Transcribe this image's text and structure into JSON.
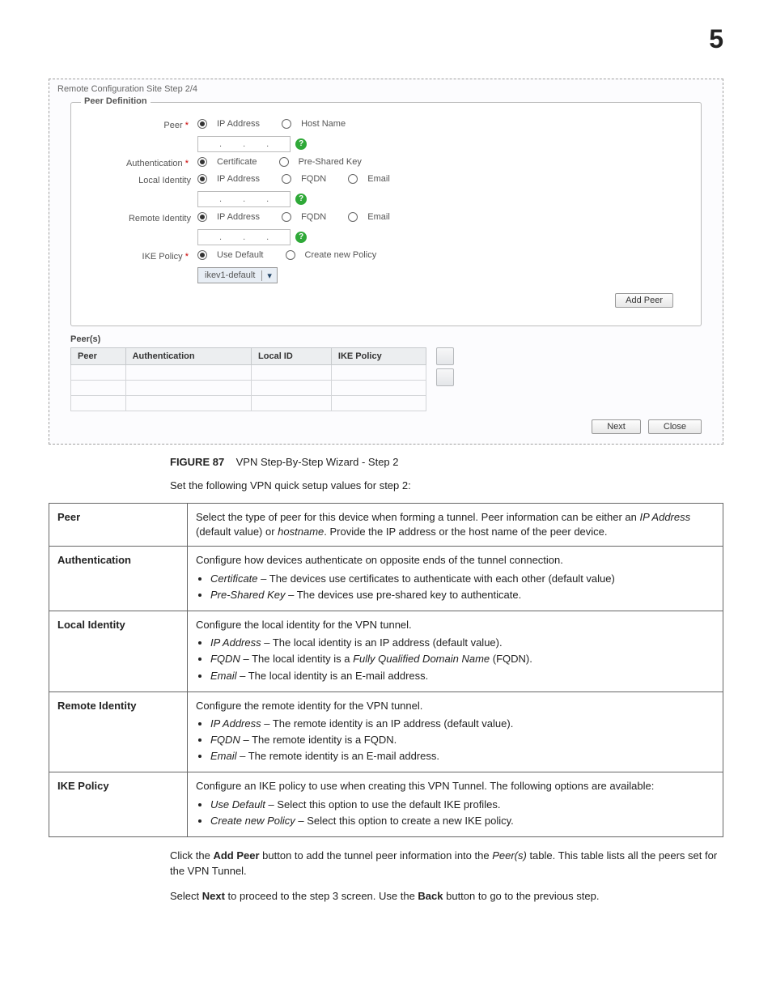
{
  "page_number": "5",
  "screenshot": {
    "title": "Remote Configuration Site  Step 2/4",
    "legend": "Peer Definition",
    "rows": {
      "peer_lbl": "Peer",
      "auth_lbl": "Authentication",
      "localid_lbl": "Local Identity",
      "remoteid_lbl": "Remote Identity",
      "ike_lbl": "IKE Policy"
    },
    "options": {
      "ip_address": "IP Address",
      "host_name": "Host Name",
      "certificate": "Certificate",
      "psk": "Pre-Shared Key",
      "fqdn": "FQDN",
      "email": "Email",
      "use_default": "Use Default",
      "create_new": "Create new Policy"
    },
    "dropdown_value": "ikev1-default",
    "add_peer_btn": "Add Peer",
    "peers_label": "Peer(s)",
    "table_headers": [
      "Peer",
      "Authentication",
      "Local ID",
      "IKE Policy"
    ],
    "footer": {
      "next": "Next",
      "close": "Close"
    }
  },
  "figure": {
    "label": "FIGURE 87",
    "caption": "VPN Step-By-Step Wizard - Step 2"
  },
  "intro": "Set the following VPN quick setup values for step 2:",
  "desc": {
    "peer": {
      "k": "Peer",
      "text_a": "Select the type of peer for this device when forming a tunnel. Peer information can be either an ",
      "ip": "IP Address",
      "text_b": " (default value) or ",
      "hn": "hostname",
      "text_c": ". Provide the IP address or the host name of the peer device."
    },
    "auth": {
      "k": "Authentication",
      "lead": "Configure how devices authenticate on opposite ends of the tunnel connection.",
      "li1_a": "Certificate",
      "li1_b": " – The devices use certificates to authenticate with each other (default value)",
      "li2_a": "Pre-Shared Key",
      "li2_b": " – The devices use pre-shared key to authenticate."
    },
    "local": {
      "k": "Local Identity",
      "lead": "Configure the local identity for the VPN tunnel.",
      "li1_a": "IP Address",
      "li1_b": " – The local identity is an IP address (default value).",
      "li2_a": "FQDN",
      "li2_b": " – The local identity is a ",
      "li2_c": "Fully Qualified Domain Name",
      "li2_d": " (FQDN).",
      "li3_a": "Email",
      "li3_b": " – The local identity is an E-mail address."
    },
    "remote": {
      "k": "Remote Identity",
      "lead": "Configure the remote identity for the VPN tunnel.",
      "li1_a": "IP Address",
      "li1_b": " – The remote identity is an IP address (default value).",
      "li2_a": "FQDN",
      "li2_b": " – The remote identity is a FQDN.",
      "li3_a": "Email",
      "li3_b": " – The remote identity is an E-mail address."
    },
    "ike": {
      "k": "IKE Policy",
      "lead": "Configure an IKE policy to use when creating this VPN Tunnel. The following options are available:",
      "li1_a": "Use Default",
      "li1_b": " – Select this option to use the default IKE profiles.",
      "li2_a": "Create new Policy",
      "li2_b": " – Select this option to create a new IKE policy."
    }
  },
  "p1_a": "Click the ",
  "p1_b": "Add Peer",
  "p1_c": " button to add the tunnel peer information into the ",
  "p1_d": "Peer(s)",
  "p1_e": " table. This table lists all the peers set for the VPN Tunnel.",
  "p2_a": "Select ",
  "p2_b": "Next",
  "p2_c": " to proceed to the step 3 screen. Use the ",
  "p2_d": "Back",
  "p2_e": " button to go to the previous step."
}
